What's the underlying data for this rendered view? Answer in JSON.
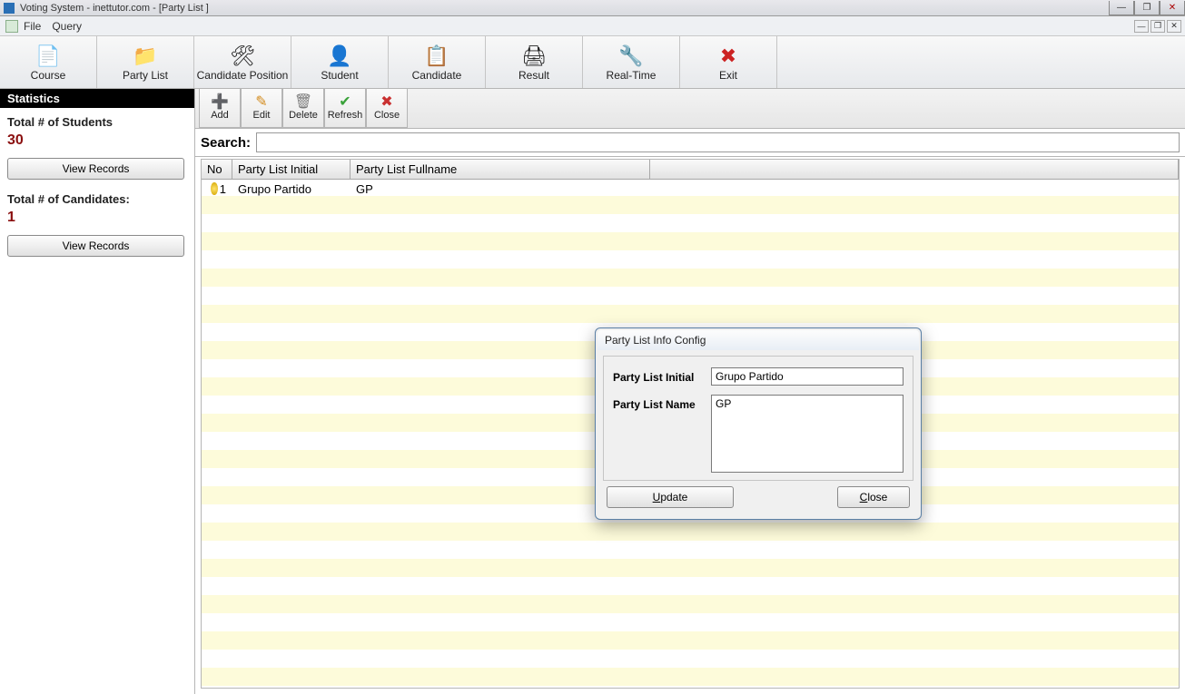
{
  "title": "Voting System - inettutor.com - [Party List ]",
  "menu": {
    "file": "File",
    "query": "Query"
  },
  "toolbar": [
    {
      "label": "Course",
      "icon": "📄"
    },
    {
      "label": "Party List",
      "icon": "📁"
    },
    {
      "label": "Candidate Position",
      "icon": "🛠"
    },
    {
      "label": "Student",
      "icon": "👤"
    },
    {
      "label": "Candidate",
      "icon": "📋"
    },
    {
      "label": "Result",
      "icon": "🖨"
    },
    {
      "label": "Real-Time",
      "icon": "🔧"
    },
    {
      "label": "Exit",
      "icon": "✖"
    }
  ],
  "sidebar": {
    "header": "Statistics",
    "students_label": "Total # of Students",
    "students_value": "30",
    "view_records": "View Records",
    "candidates_label": "Total # of Candidates:",
    "candidates_value": "1"
  },
  "subtoolbar": [
    {
      "label": "Add",
      "icon": "➕",
      "color": "#2e9b2e"
    },
    {
      "label": "Edit",
      "icon": "✎",
      "color": "#d38a1b"
    },
    {
      "label": "Delete",
      "icon": "🗑",
      "color": "#7a7a7a"
    },
    {
      "label": "Refresh",
      "icon": "✔",
      "color": "#3aa23a"
    },
    {
      "label": "Close",
      "icon": "✖",
      "color": "#c93030"
    }
  ],
  "search": {
    "label": "Search:",
    "value": ""
  },
  "grid": {
    "columns": [
      "No",
      "Party List Initial",
      "Party List Fullname"
    ],
    "rows": [
      {
        "no": "1",
        "initial": "Grupo Partido",
        "fullname": "GP"
      }
    ]
  },
  "dialog": {
    "title": "Party List Info Config",
    "initial_label": "Party List Initial",
    "initial_value": "Grupo Partido",
    "name_label": "Party List Name",
    "name_value": "GP",
    "update": "pdate",
    "update_u": "U",
    "close": "lose",
    "close_u": "C"
  }
}
